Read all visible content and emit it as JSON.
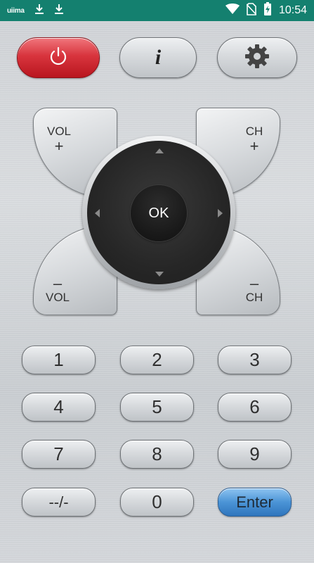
{
  "status_bar": {
    "carrier": "uiima",
    "time": "10:54",
    "icons": [
      "download-icon",
      "download-icon",
      "wifi-icon",
      "no-sim-icon",
      "battery-charging-icon"
    ]
  },
  "top_row": {
    "power_icon": "power-icon",
    "info_label": "i",
    "settings_icon": "gear-icon"
  },
  "vol_ch": {
    "vol_plus": {
      "line1": "VOL",
      "line2": "+"
    },
    "ch_plus": {
      "line1": "CH",
      "line2": "+"
    },
    "vol_minus": {
      "line1": "–",
      "line2": "VOL"
    },
    "ch_minus": {
      "line1": "–",
      "line2": "CH"
    }
  },
  "dpad": {
    "ok_label": "OK"
  },
  "keypad": {
    "k1": "1",
    "k2": "2",
    "k3": "3",
    "k4": "4",
    "k5": "5",
    "k6": "6",
    "k7": "7",
    "k8": "8",
    "k9": "9",
    "dash": "--/-",
    "k0": "0",
    "enter": "Enter"
  },
  "colors": {
    "status_bar": "#14806f",
    "power": "#d8343d",
    "enter": "#4b94d6",
    "dpad": "#262626"
  }
}
